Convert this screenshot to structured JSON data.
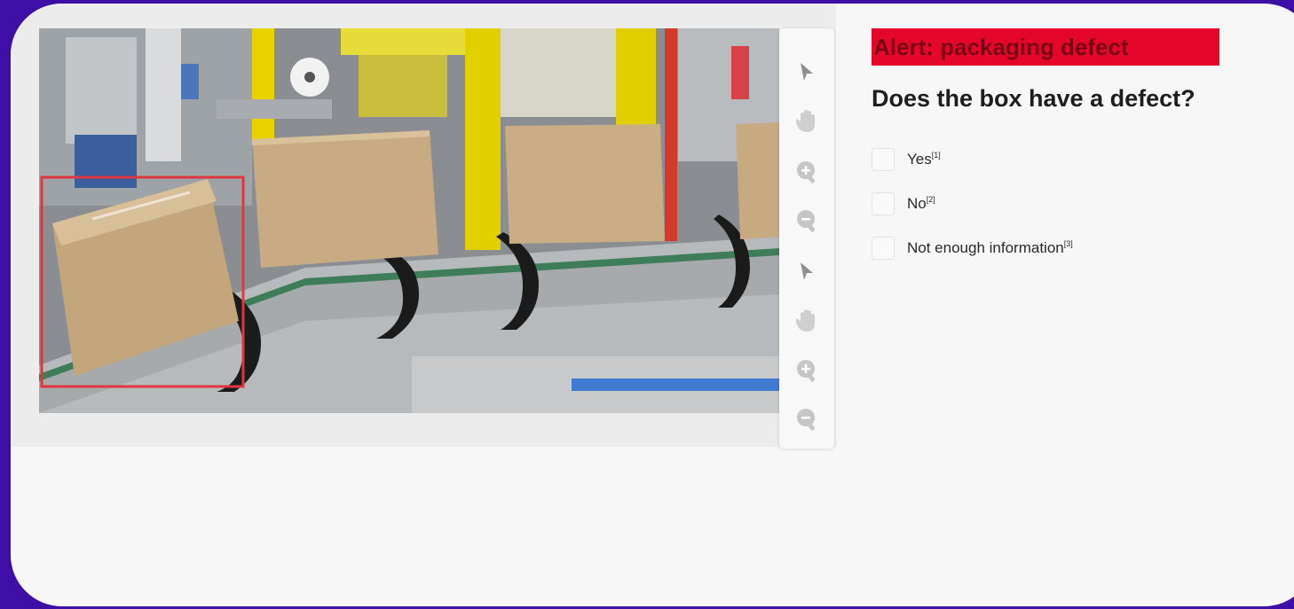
{
  "alert": {
    "text": "Alert: packaging defect",
    "color": "#e5062b"
  },
  "question": "Does the box have a defect?",
  "options": [
    {
      "label": "Yes",
      "ref": "[1]",
      "checked": false
    },
    {
      "label": "No",
      "ref": "[2]",
      "checked": false
    },
    {
      "label": "Not enough information",
      "ref": "[3]",
      "checked": false
    }
  ],
  "toolbar": {
    "tools": [
      "pointer-icon",
      "hand-icon",
      "zoom-in-icon",
      "zoom-out-icon",
      "pointer-icon",
      "hand-icon",
      "zoom-in-icon",
      "zoom-out-icon"
    ]
  },
  "annotation": {
    "label": "defect-bounding-box",
    "color": "#e03640"
  },
  "colors": {
    "frame": "#3d0fa6",
    "panel": "#f7f7f7",
    "icon": "#bfbfbf"
  }
}
